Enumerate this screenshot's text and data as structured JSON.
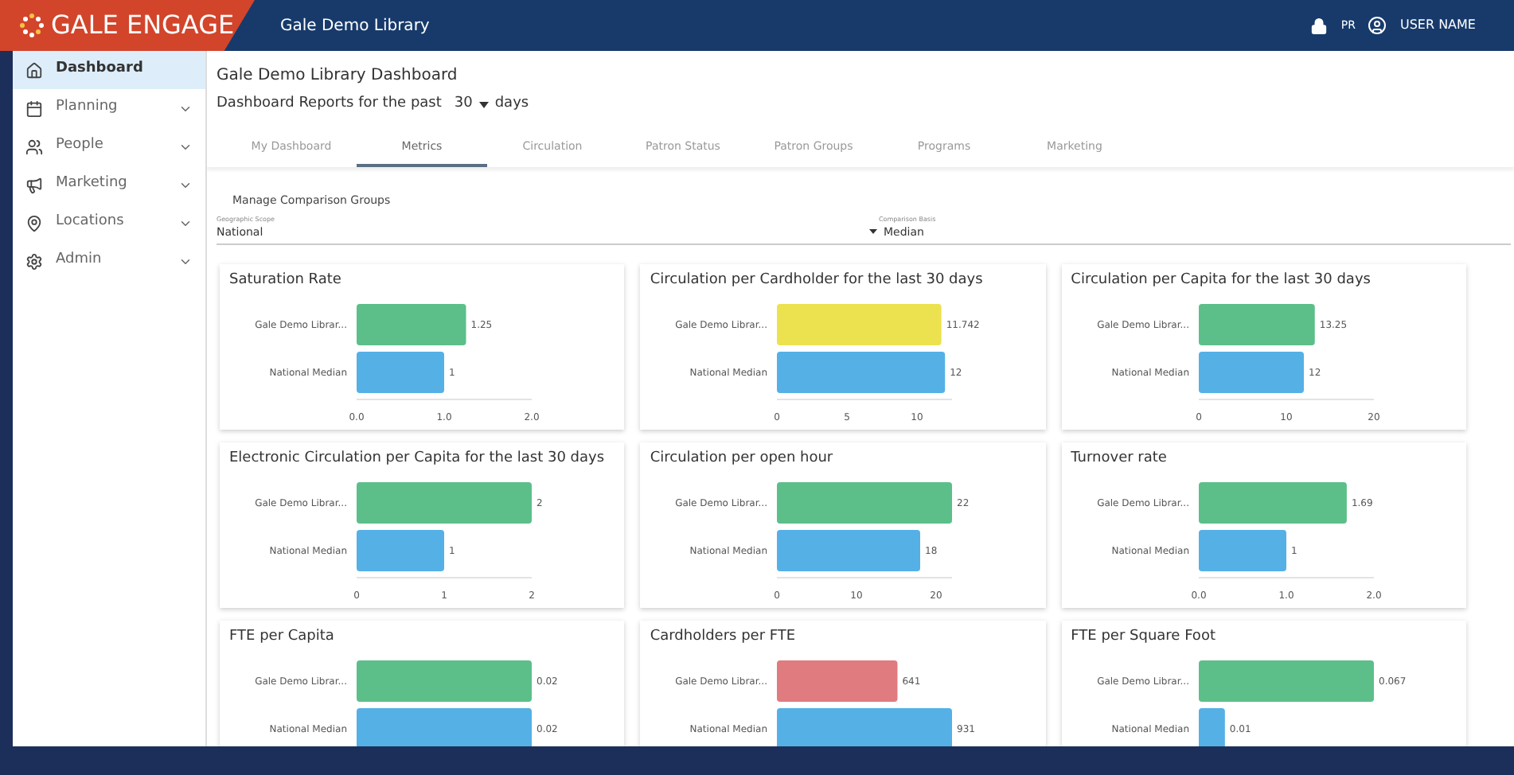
{
  "header": {
    "logo": "GALE ENGAGE",
    "library": "Gale Demo Library",
    "badge": "PR",
    "user": "USER NAME"
  },
  "sidebar": {
    "items": [
      {
        "label": "Dashboard",
        "selected": true,
        "expandable": false
      },
      {
        "label": "Planning",
        "selected": false,
        "expandable": true
      },
      {
        "label": "People",
        "selected": false,
        "expandable": true
      },
      {
        "label": "Marketing",
        "selected": false,
        "expandable": true
      },
      {
        "label": "Locations",
        "selected": false,
        "expandable": true
      },
      {
        "label": "Admin",
        "selected": false,
        "expandable": true
      }
    ]
  },
  "page": {
    "title": "Gale Demo Library Dashboard",
    "period_prefix": "Dashboard Reports for the past",
    "period_value": "30",
    "period_suffix": "days"
  },
  "tabs": [
    {
      "label": "My Dashboard",
      "selected": false
    },
    {
      "label": "Metrics",
      "selected": true
    },
    {
      "label": "Circulation",
      "selected": false
    },
    {
      "label": "Patron Status",
      "selected": false
    },
    {
      "label": "Patron Groups",
      "selected": false
    },
    {
      "label": "Programs",
      "selected": false
    },
    {
      "label": "Marketing",
      "selected": false
    }
  ],
  "filters": {
    "link": "Manage Comparison Groups",
    "scope_label": "Geographic Scope",
    "scope_value": "National",
    "basis_label": "Comparison Basis",
    "basis_value": "Median"
  },
  "cards": [
    {
      "title": "Saturation Rate",
      "chart_data": {
        "type": "bar",
        "orientation": "horizontal",
        "categories": [
          "Gale Demo Librar...",
          "National Median"
        ],
        "values": [
          1.25,
          1
        ],
        "colors": [
          "#5cbf8a",
          "#55b0e6"
        ],
        "value_labels": [
          "1.25",
          "1"
        ],
        "xlim": [
          0,
          2
        ],
        "xticks": [
          {
            "value": 0,
            "label": "0.0"
          },
          {
            "value": 1,
            "label": "1.0"
          },
          {
            "value": 2,
            "label": "2.0"
          }
        ]
      }
    },
    {
      "title": "Circulation per Cardholder for the last 30 days",
      "chart_data": {
        "type": "bar",
        "orientation": "horizontal",
        "categories": [
          "Gale Demo Librar...",
          "National Median"
        ],
        "values": [
          11.742,
          12
        ],
        "colors": [
          "#ece24f",
          "#55b0e6"
        ],
        "value_labels": [
          "11.742",
          "12"
        ],
        "xlim": [
          0,
          12.5
        ],
        "xticks": [
          0,
          5,
          10
        ]
      }
    },
    {
      "title": "Circulation per Capita for the last 30 days",
      "chart_data": {
        "type": "bar",
        "orientation": "horizontal",
        "categories": [
          "Gale Demo Librar...",
          "National Median"
        ],
        "values": [
          13.25,
          12
        ],
        "colors": [
          "#5cbf8a",
          "#55b0e6"
        ],
        "value_labels": [
          "13.25",
          "12"
        ],
        "xlim": [
          0,
          20
        ],
        "xticks": [
          0,
          10,
          20
        ]
      }
    },
    {
      "title": "Electronic Circulation per Capita for the last 30 days",
      "chart_data": {
        "type": "bar",
        "orientation": "horizontal",
        "categories": [
          "Gale Demo Librar...",
          "National Median"
        ],
        "values": [
          2,
          1
        ],
        "colors": [
          "#5cbf8a",
          "#55b0e6"
        ],
        "value_labels": [
          "2",
          "1"
        ],
        "xlim": [
          0,
          2
        ],
        "xticks": [
          0,
          1,
          2
        ]
      }
    },
    {
      "title": "Circulation per open hour",
      "chart_data": {
        "type": "bar",
        "orientation": "horizontal",
        "categories": [
          "Gale Demo Librar...",
          "National Median"
        ],
        "values": [
          22,
          18
        ],
        "colors": [
          "#5cbf8a",
          "#55b0e6"
        ],
        "value_labels": [
          "22",
          "18"
        ],
        "xlim": [
          0,
          22
        ],
        "xticks": [
          0,
          10,
          20
        ]
      }
    },
    {
      "title": "Turnover rate",
      "chart_data": {
        "type": "bar",
        "orientation": "horizontal",
        "categories": [
          "Gale Demo Librar...",
          "National Median"
        ],
        "values": [
          1.69,
          1
        ],
        "colors": [
          "#5cbf8a",
          "#55b0e6"
        ],
        "value_labels": [
          "1.69",
          "1"
        ],
        "xlim": [
          0,
          2
        ],
        "xticks": [
          {
            "value": 0,
            "label": "0.0"
          },
          {
            "value": 1,
            "label": "1.0"
          },
          {
            "value": 2,
            "label": "2.0"
          }
        ]
      }
    },
    {
      "title": "FTE per Capita",
      "chart_data": {
        "type": "bar",
        "orientation": "horizontal",
        "categories": [
          "Gale Demo Librar...",
          "National Median"
        ],
        "values": [
          0.02,
          0.02
        ],
        "colors": [
          "#5cbf8a",
          "#55b0e6"
        ],
        "value_labels": [
          "0.02",
          "0.02"
        ]
      }
    },
    {
      "title": "Cardholders per FTE",
      "chart_data": {
        "type": "bar",
        "orientation": "horizontal",
        "categories": [
          "Gale Demo Librar...",
          "National Median"
        ],
        "values": [
          641,
          931
        ],
        "colors": [
          "#e07b80",
          "#55b0e6"
        ],
        "value_labels": [
          "641",
          "931"
        ]
      }
    },
    {
      "title": "FTE per Square Foot",
      "chart_data": {
        "type": "bar",
        "orientation": "horizontal",
        "categories": [
          "Gale Demo Librar...",
          "National Median"
        ],
        "values": [
          0.067,
          0.01
        ],
        "colors": [
          "#5cbf8a",
          "#55b0e6"
        ],
        "value_labels": [
          "0.067",
          "0.01"
        ]
      }
    }
  ]
}
